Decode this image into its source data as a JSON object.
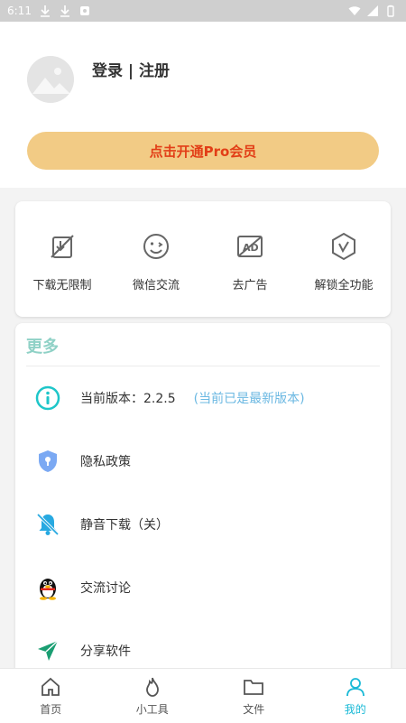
{
  "status_bar": {
    "time": "6:11"
  },
  "profile": {
    "login_label": "登录 | 注册"
  },
  "pro_button": {
    "label": "点击开通Pro会员"
  },
  "features": [
    {
      "icon": "no-limit-download-icon",
      "label": "下载无限制"
    },
    {
      "icon": "smiley-icon",
      "label": "微信交流"
    },
    {
      "icon": "no-ad-icon",
      "label": "去广告"
    },
    {
      "icon": "unlock-badge-icon",
      "label": "解锁全功能"
    }
  ],
  "more": {
    "title": "更多",
    "items": [
      {
        "icon": "info-icon",
        "label": "当前版本：2.2.5",
        "note": "(当前已是最新版本)"
      },
      {
        "icon": "shield-lock-icon",
        "label": "隐私政策"
      },
      {
        "icon": "bell-off-icon",
        "label": "静音下载（关）"
      },
      {
        "icon": "qq-penguin-icon",
        "label": "交流讨论"
      },
      {
        "icon": "send-icon",
        "label": "分享软件"
      }
    ]
  },
  "tabs": [
    {
      "icon": "home-icon",
      "label": "首页",
      "active": false
    },
    {
      "icon": "flame-icon",
      "label": "小工具",
      "active": false
    },
    {
      "icon": "folder-icon",
      "label": "文件",
      "active": false
    },
    {
      "icon": "person-icon",
      "label": "我的",
      "active": true
    }
  ],
  "colors": {
    "accent": "#19b9d6",
    "pro_button_bg": "#f2cb85",
    "pro_button_text": "#e23e17",
    "more_title": "#8fd1c6",
    "version_note": "#6bb8e2"
  }
}
